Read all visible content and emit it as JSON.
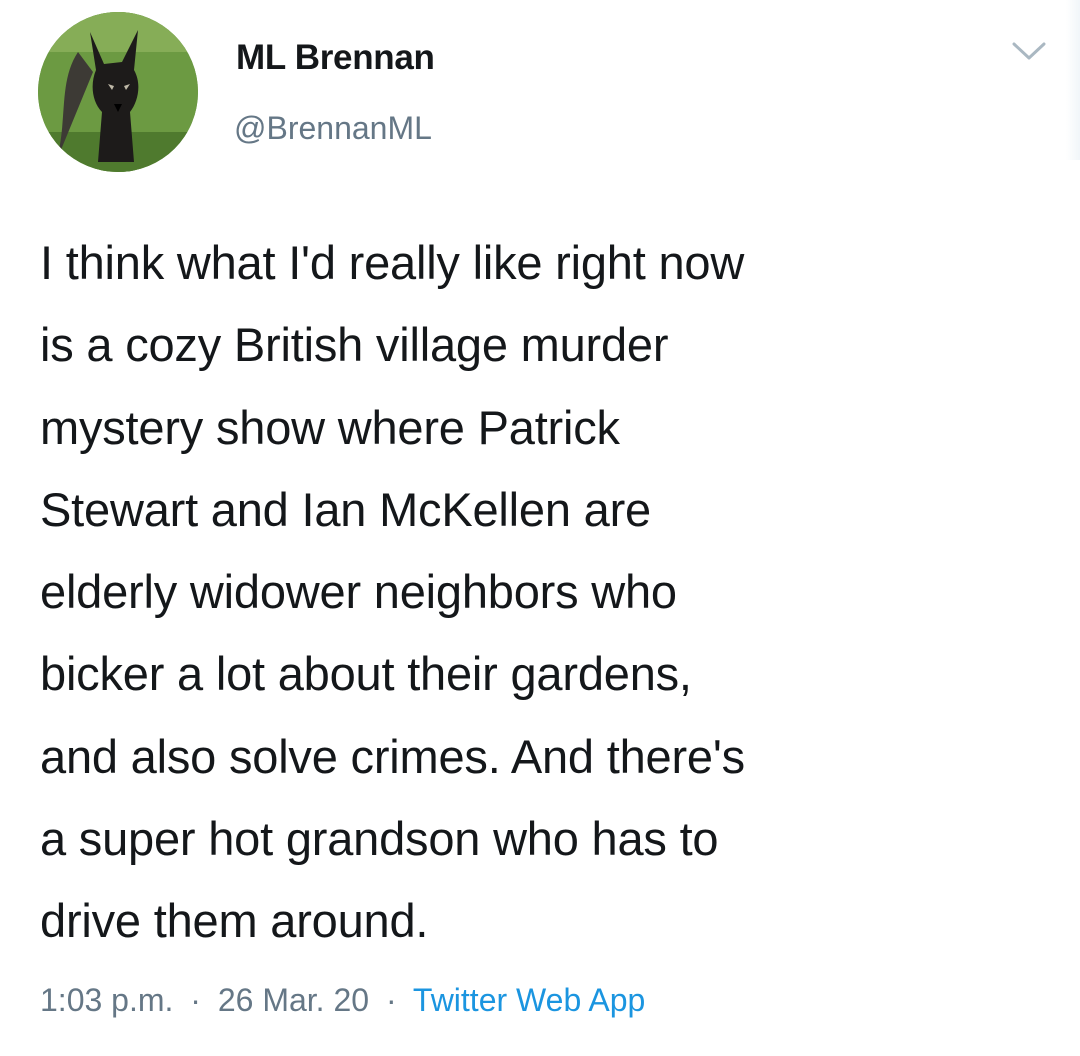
{
  "author": {
    "display_name": "ML Brennan",
    "handle": "@BrennanML",
    "avatar_icon": "avatar-photo"
  },
  "tweet": {
    "lines": [
      "I think what I'd really like right now",
      "is a cozy British village murder",
      "mystery show where Patrick",
      "Stewart and Ian McKellen are",
      "elderly widower neighbors who",
      "bicker a lot about their gardens,",
      "and also solve crimes. And there's",
      "a super hot grandson who has to",
      "drive them around."
    ]
  },
  "meta": {
    "time": "1:03 p.m.",
    "separator": "·",
    "date": "26 Mar. 20",
    "source": "Twitter Web App"
  },
  "icons": {
    "menu": "chevron-down-icon"
  },
  "colors": {
    "text": "#14171a",
    "secondary": "#657786",
    "link": "#1b95e0"
  }
}
